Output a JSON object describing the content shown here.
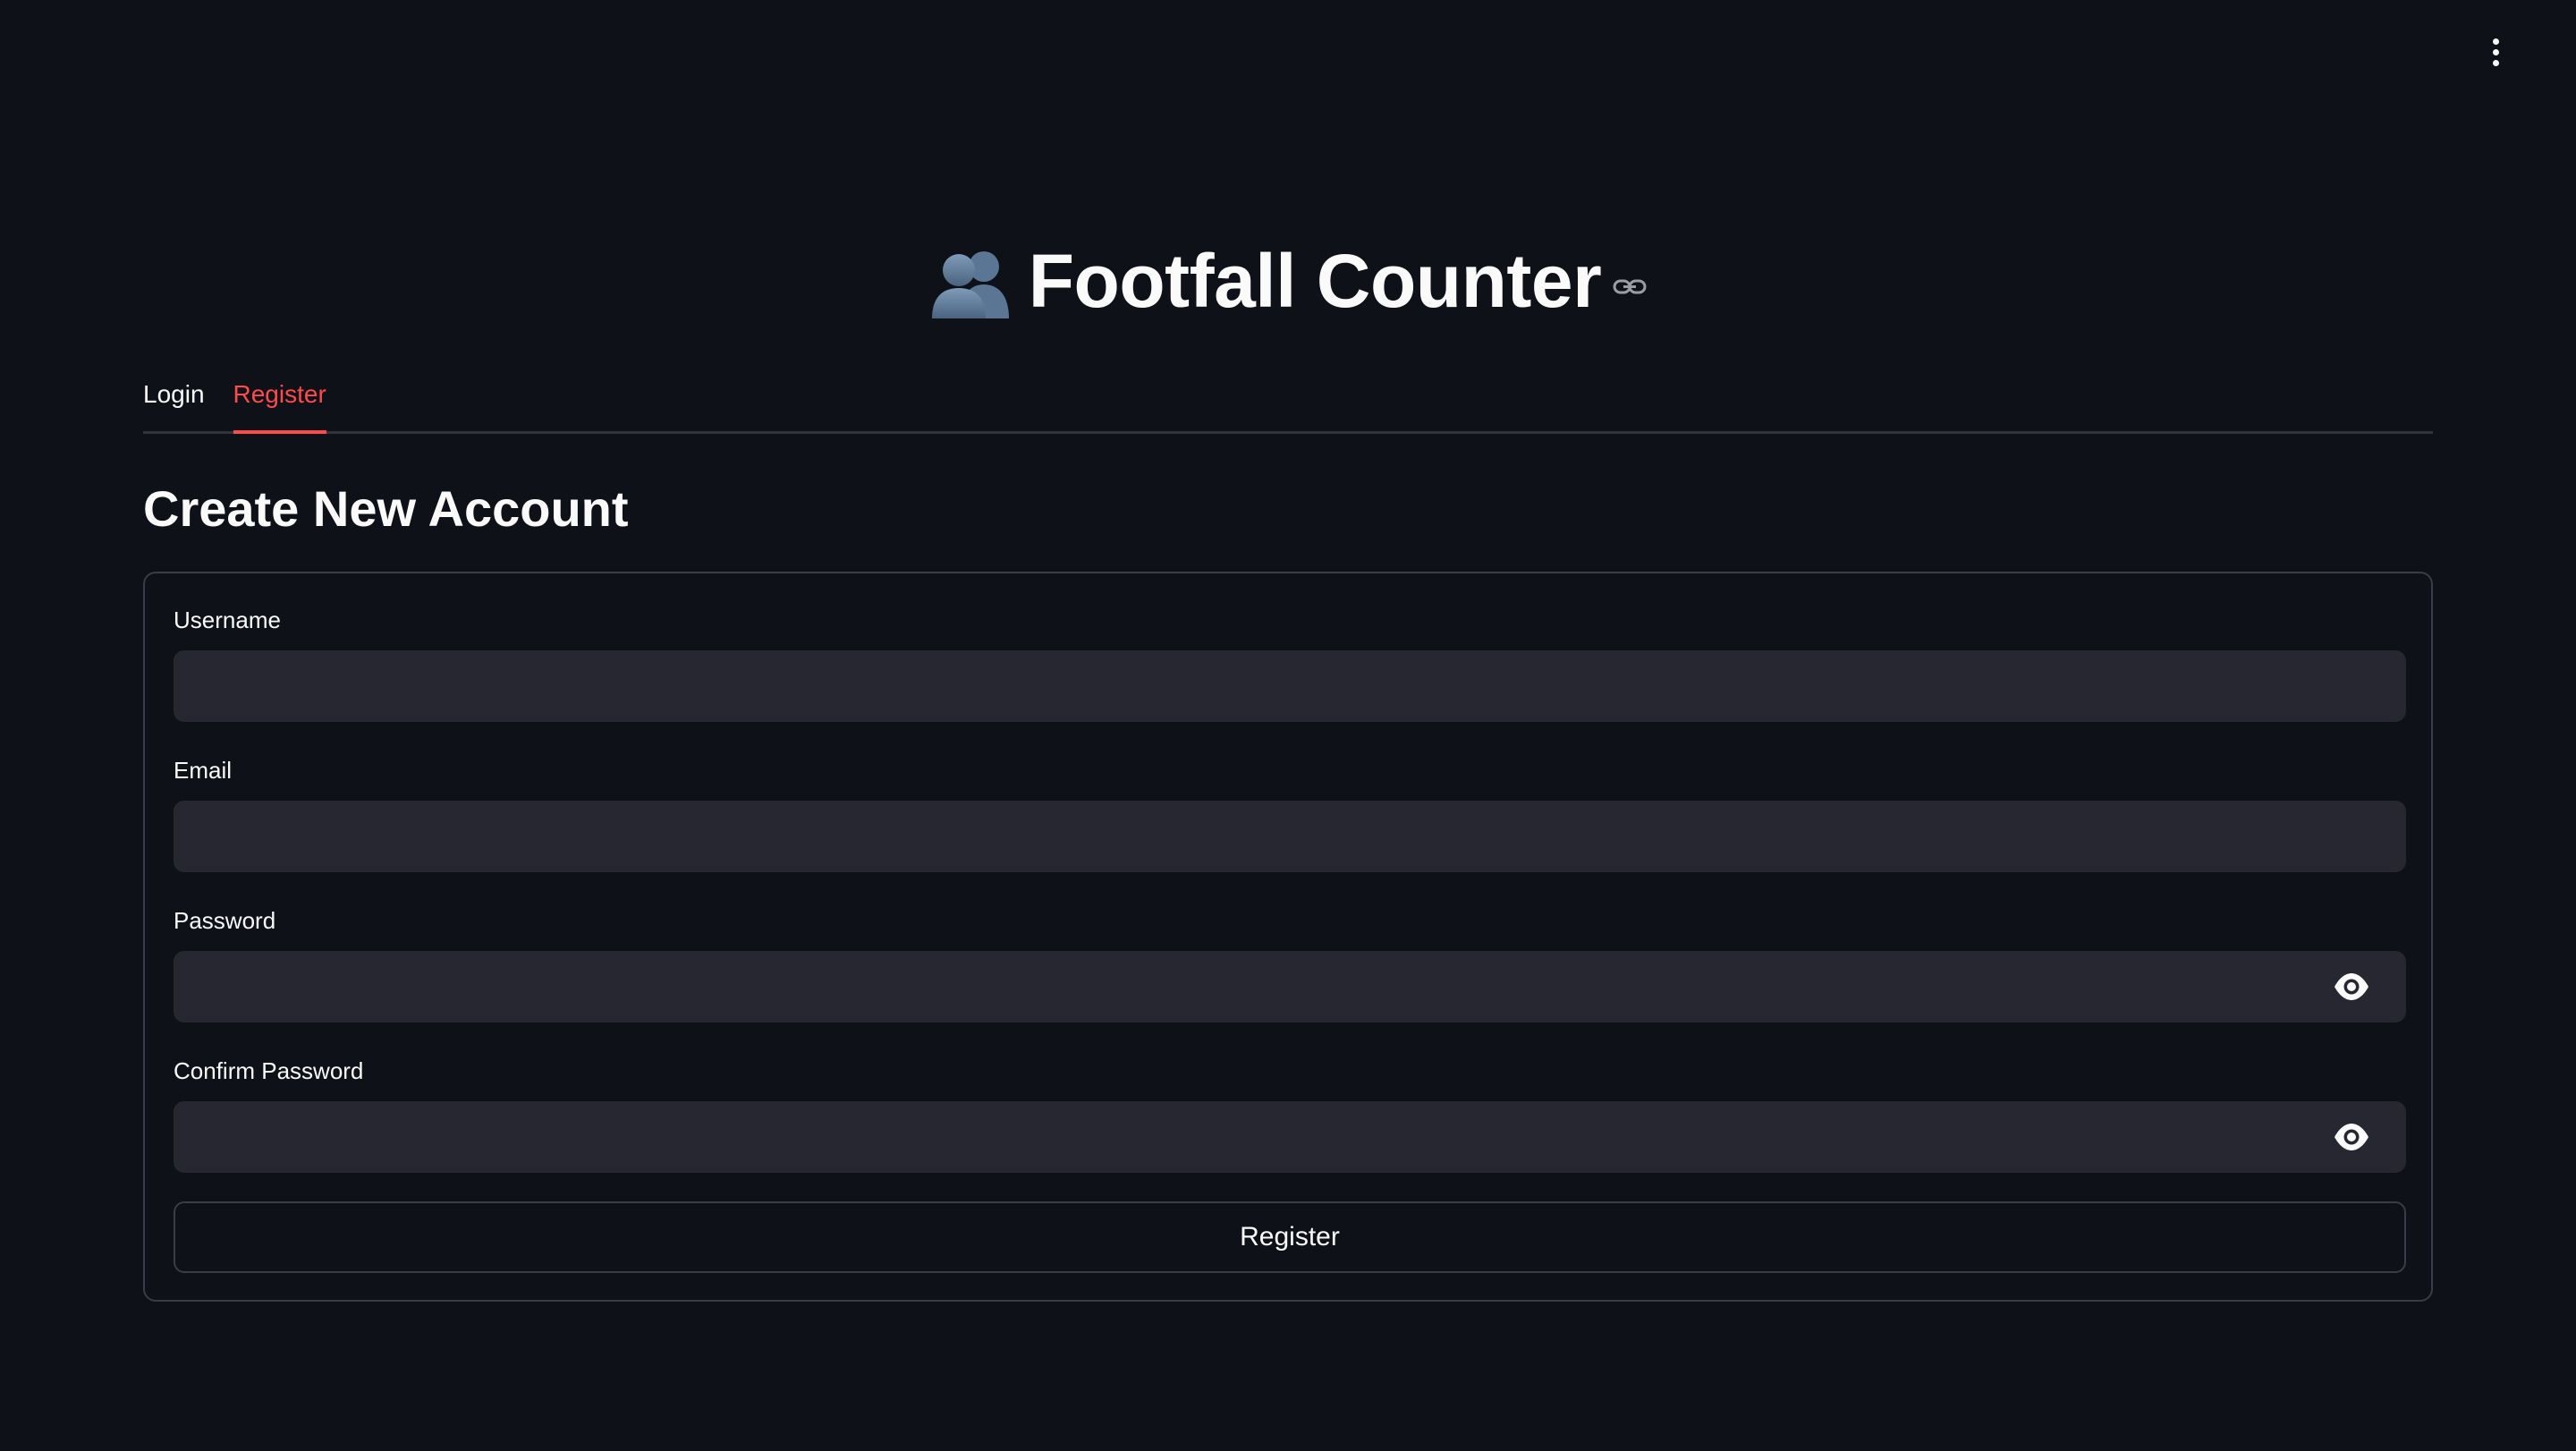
{
  "header": {
    "title": "Footfall Counter",
    "title_icon": "busts-in-silhouette-emoji",
    "menu_icon": "vertical-ellipsis-icon",
    "link_icon": "link-icon"
  },
  "tabs": [
    {
      "label": "Login",
      "active": false
    },
    {
      "label": "Register",
      "active": true
    }
  ],
  "form": {
    "heading": "Create New Account",
    "fields": [
      {
        "label": "Username",
        "value": "",
        "type": "text"
      },
      {
        "label": "Email",
        "value": "",
        "type": "text"
      },
      {
        "label": "Password",
        "value": "",
        "type": "password",
        "icon": "eye-icon"
      },
      {
        "label": "Confirm Password",
        "value": "",
        "type": "password",
        "icon": "eye-icon"
      }
    ],
    "submit_label": "Register"
  },
  "colors": {
    "background": "#0e1117",
    "accent": "#ff4b4b",
    "input_background": "#262730",
    "border": "#3a3c48",
    "text": "#fafafa"
  }
}
